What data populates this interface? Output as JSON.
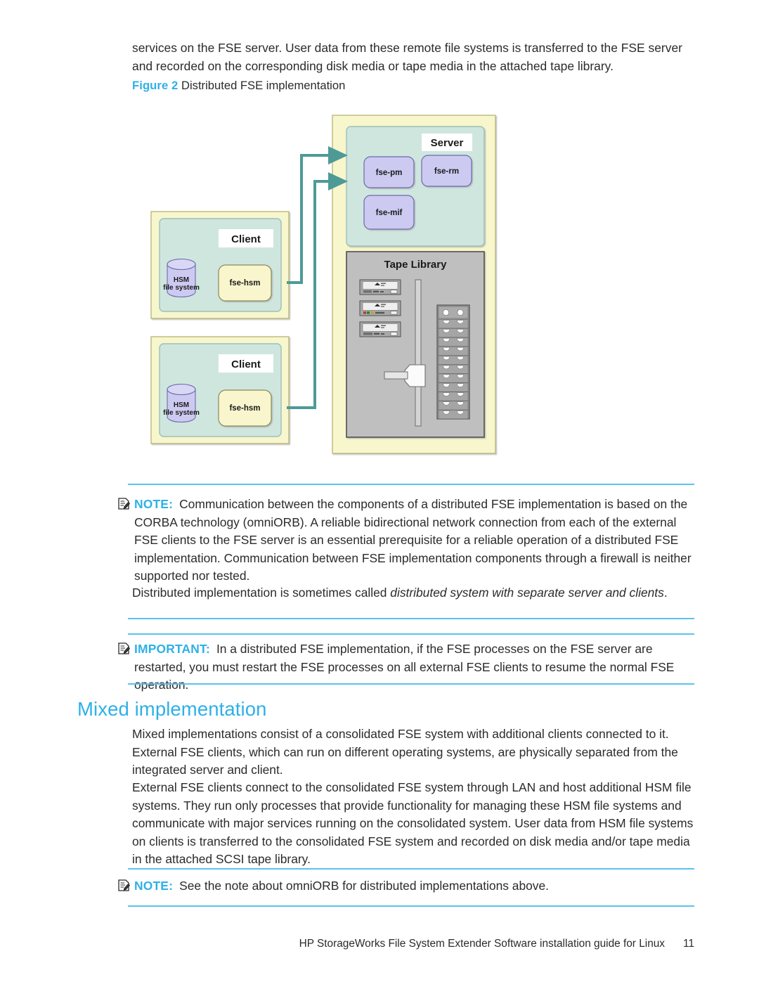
{
  "page": {
    "intro_paragraph": "services on the FSE server. User data from these remote file systems is transferred to the FSE server and recorded on the corresponding disk media or tape media in the attached tape library.",
    "footer_text": "HP StorageWorks File System Extender Software installation guide for Linux",
    "page_number": "11",
    "accent_color": "#2eb0e8",
    "rule_color": "#5bc2ef"
  },
  "figure": {
    "label": "Figure 2",
    "caption": "Distributed FSE implementation",
    "colors": {
      "outer_box": "#f8f6cd",
      "outer_box_border": "#bfbf7a",
      "inner_box": "#cfe6df",
      "inner_box_border": "#9bc0b6",
      "process_box": "#cdcaf2",
      "process_box_border": "#6b6ba8",
      "hsm_box": "#f9f6cd",
      "hsm_box_border": "#8a8a5a",
      "tape_library_bg": "#bfbfbf",
      "tape_library_border": "#555555",
      "arrow": "#4e9a96",
      "label_bg": "#ffffff"
    },
    "clients": [
      {
        "title": "Client",
        "storage_label_line1": "HSM",
        "storage_label_line2": "file system",
        "process_label": "fse-hsm"
      },
      {
        "title": "Client",
        "storage_label_line1": "HSM",
        "storage_label_line2": "file system",
        "process_label": "fse-hsm"
      }
    ],
    "server": {
      "title": "Server",
      "processes": [
        "fse-pm",
        "fse-rm",
        "fse-mif"
      ]
    },
    "tape_library": {
      "title": "Tape Library",
      "drive_count": 3,
      "magazine_slot_rows": 11
    }
  },
  "note_distributed": {
    "icon": "note-icon",
    "keyword": "NOTE:",
    "text": "Communication between the components of a distributed FSE implementation is based on the CORBA technology (omniORB). A reliable bidirectional network connection from each of the external FSE clients to the FSE server is an essential prerequisite for a reliable operation of a distributed FSE implementation. Communication between FSE implementation components through a firewall is neither supported nor tested."
  },
  "distributed_alias": {
    "lead": "Distributed implementation is sometimes called ",
    "italic": "distributed system with separate server and clients",
    "trail": "."
  },
  "important_block": {
    "icon": "important-icon",
    "keyword": "IMPORTANT:",
    "text": "In a distributed FSE implementation, if the FSE processes on the FSE server are restarted, you must restart the FSE processes on all external FSE clients to resume the normal FSE operation."
  },
  "mixed_section": {
    "heading": "Mixed implementation",
    "paragraph_1": "Mixed implementations consist of a consolidated FSE system with additional clients connected to it. External FSE clients, which can run on different operating systems, are physically separated from the integrated server and client.",
    "paragraph_2": "External FSE clients connect to the consolidated FSE system through LAN and host additional HSM file systems. They run only processes that provide functionality for managing these HSM file systems and communicate with major services running on the consolidated system. User data from HSM file systems on clients is transferred to the consolidated FSE system and recorded on disk media and/or tape media in the attached SCSI tape library."
  },
  "note_mixed": {
    "icon": "note-icon",
    "keyword": "NOTE:",
    "text": "See the note about omniORB for distributed implementations above."
  }
}
